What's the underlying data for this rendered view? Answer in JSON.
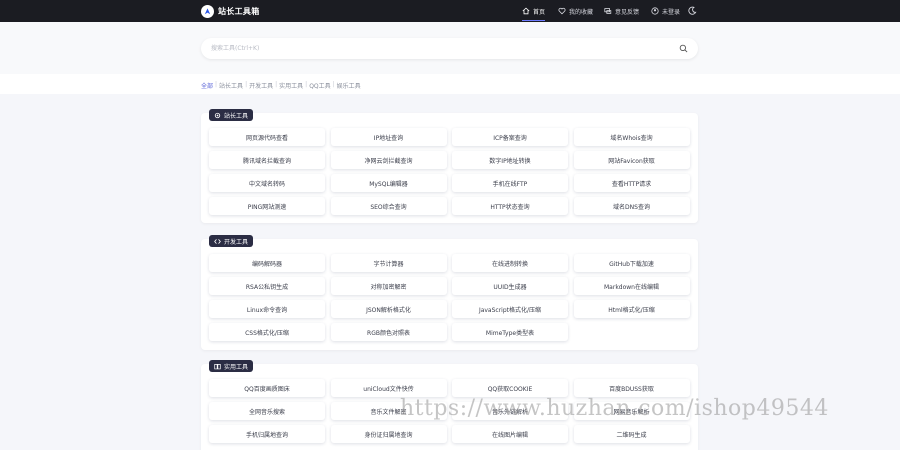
{
  "app": {
    "brand_name": "站长工具箱",
    "accent_color": "#5a63d8",
    "topbar_color": "#1b1c22"
  },
  "nav": {
    "items": [
      {
        "label": "首页",
        "icon": "home-icon",
        "active": true
      },
      {
        "label": "我的收藏",
        "icon": "heart-icon",
        "active": false
      },
      {
        "label": "意见反馈",
        "icon": "message-icon",
        "active": false
      },
      {
        "label": "未登录",
        "icon": "user-icon",
        "active": false
      }
    ],
    "theme_icon": "moon-icon"
  },
  "search": {
    "placeholder": "搜索工具(Ctrl+K)",
    "value": "",
    "button_icon": "search-icon"
  },
  "filters": [
    "全部",
    "站长工具",
    "开发工具",
    "实用工具",
    "QQ工具",
    "娱乐工具"
  ],
  "sections": [
    {
      "title": "站长工具",
      "icon": "gear-icon",
      "tools": [
        "网页源代码查看",
        "IP地址查询",
        "ICP备案查询",
        "域名Whois查询",
        "腾讯域名拦截查询",
        "净网云剑拦截查询",
        "数字IP地址转换",
        "网站Favicon获取",
        "中文域名转码",
        "MySQL编辑器",
        "手机在线FTP",
        "查看HTTP请求",
        "PING网站测速",
        "SEO综合查询",
        "HTTP状态查询",
        "域名DNS查询"
      ]
    },
    {
      "title": "开发工具",
      "icon": "code-icon",
      "tools": [
        "编码解码器",
        "字节计算器",
        "在线进制转换",
        "GitHub下载加速",
        "RSA公私钥生成",
        "对称加密解密",
        "UUID生成器",
        "Markdown在线编辑",
        "Linux命令查询",
        "JSON解析格式化",
        "JavaScript格式化/压缩",
        "Html格式化/压缩",
        "CSS格式化/压缩",
        "RGB颜色对照表",
        "MimeType类型表"
      ]
    },
    {
      "title": "实用工具",
      "icon": "book-icon",
      "tools": [
        "QQ百度画质图床",
        "uniCloud文件快传",
        "QQ获取COOKIE",
        "百度BDUSS获取",
        "全网音乐搜索",
        "音乐文件解密",
        "音乐外链解析",
        "网易音乐解析",
        "手机归属地查询",
        "身份证归属地查询",
        "在线图片编辑",
        "二维码生成"
      ]
    }
  ],
  "watermark": "https://www.huzhan.com/ishop49544"
}
